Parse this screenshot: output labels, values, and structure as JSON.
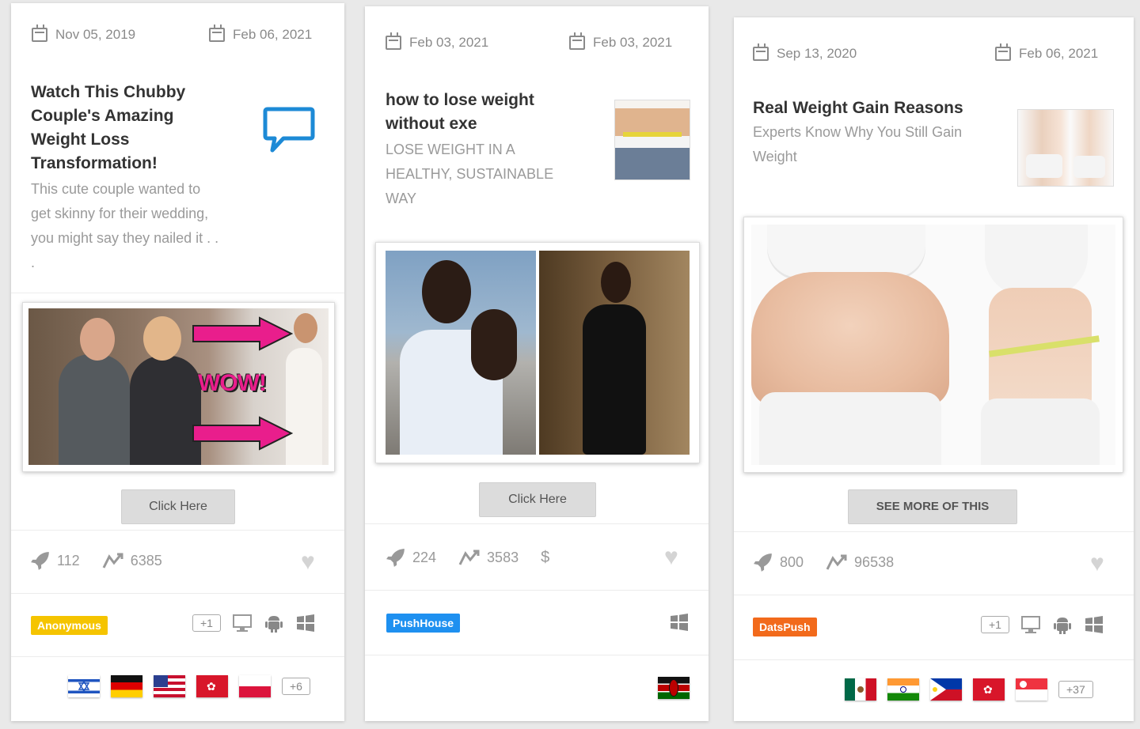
{
  "cards": [
    {
      "start_date": "Nov 05, 2019",
      "end_date": "Feb 06, 2021",
      "title": "Watch This Chubby Couple's Amazing Weight Loss Transformation!",
      "description": "This cute couple wanted to get skinny for their wedding, you might say they nailed it . . .",
      "image_text": "WOW!",
      "cta": "Click Here",
      "likes": "112",
      "impressions": "6385",
      "network": "Anonymous",
      "network_color": "#f5c400",
      "devices_extra": "+1",
      "countries_extra": "+6"
    },
    {
      "start_date": "Feb 03, 2021",
      "end_date": "Feb 03, 2021",
      "title": "how to lose weight without exe",
      "description": "LOSE WEIGHT IN A HEALTHY, SUSTAINABLE WAY",
      "cta": "Click Here",
      "likes": "224",
      "impressions": "3583",
      "currency": "$",
      "network": "PushHouse",
      "network_color": "#1e90f0"
    },
    {
      "start_date": "Sep 13, 2020",
      "end_date": "Feb 06, 2021",
      "title": "Real Weight Gain Reasons",
      "description": "Experts Know Why You Still Gain Weight",
      "cta": "SEE MORE OF THIS",
      "likes": "800",
      "impressions": "96538",
      "network": "DatsPush",
      "network_color": "#f26a1b",
      "devices_extra": "+1",
      "countries_extra": "+37"
    }
  ]
}
